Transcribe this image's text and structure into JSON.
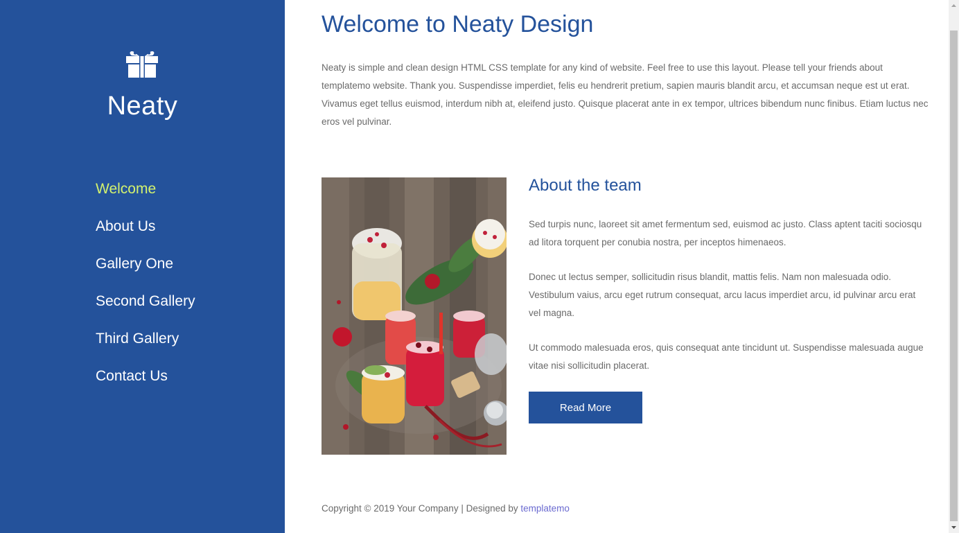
{
  "sidebar": {
    "logo_icon": "gift-icon",
    "brand": "Neaty",
    "nav": [
      {
        "label": "Welcome",
        "active": true
      },
      {
        "label": "About Us"
      },
      {
        "label": "Gallery One"
      },
      {
        "label": "Second Gallery"
      },
      {
        "label": "Third Gallery"
      },
      {
        "label": "Contact Us"
      }
    ]
  },
  "main": {
    "title": "Welcome to Neaty Design",
    "intro": "Neaty is simple and clean design HTML CSS template for any kind of website. Feel free to use this layout. Please tell your friends about templatemo website. Thank you. Suspendisse imperdiet, felis eu hendrerit pretium, sapien mauris blandit arcu, et accumsan neque est ut erat. Vivamus eget tellus euismod, interdum nibh at, eleifend justo. Quisque placerat ante in ex tempor, ultrices bibendum nunc finibus. Etiam luctus nec eros vel pulvinar.",
    "about": {
      "title": "About the team",
      "paragraphs": [
        "Sed turpis nunc, laoreet sit amet fermentum sed, euismod ac justo. Class aptent taciti sociosqu ad litora torquent per conubia nostra, per inceptos himenaeos.",
        "Donec ut lectus semper, sollicitudin risus blandit, mattis felis. Nam non malesuada odio. Vestibulum vaius, arcu eget rutrum consequat, arcu lacus imperdiet arcu, id pulvinar arcu erat vel magna.",
        "Ut commodo malesuada eros, quis consequat ante tincidunt ut. Suspendisse malesuada augue vitae nisi sollicitudin placerat."
      ],
      "button": "Read More"
    },
    "footer": {
      "text": "Copyright © 2019 Your Company | Designed by ",
      "link": "templatemo"
    }
  },
  "colors": {
    "sidebar_bg": "#24529b",
    "accent": "#d3f26e",
    "title": "#24529b",
    "body_text": "#6a6a6a",
    "link": "#6a6ad0"
  }
}
